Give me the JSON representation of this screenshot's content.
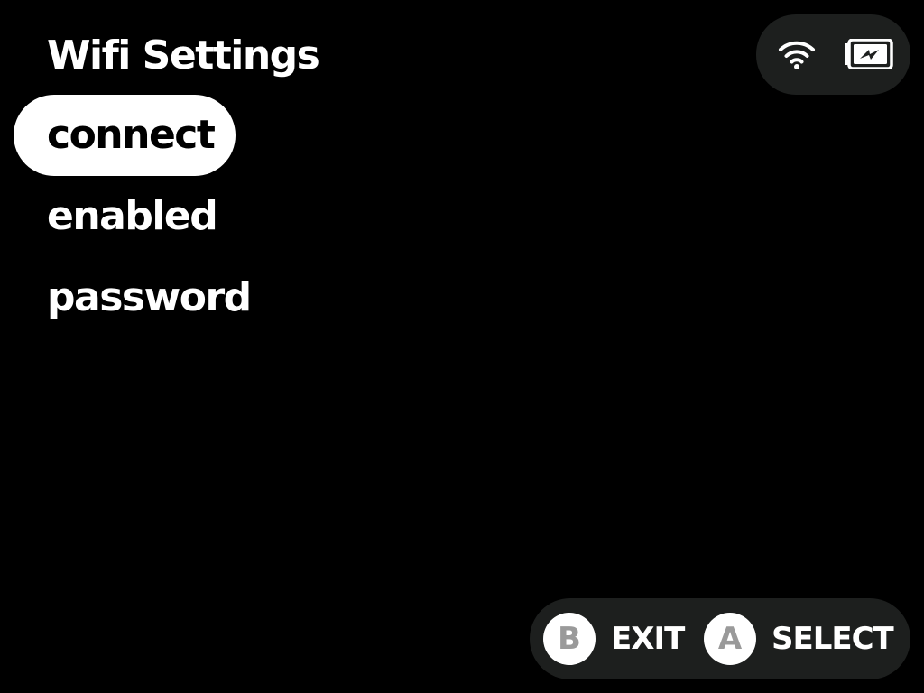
{
  "header": {
    "title": "Wifi Settings"
  },
  "status": {
    "wifi_icon": "wifi-icon",
    "battery_icon": "battery-charging-icon"
  },
  "menu": {
    "items": [
      {
        "label": "connect",
        "selected": true
      },
      {
        "label": "enabled",
        "selected": false
      },
      {
        "label": "password",
        "selected": false
      }
    ]
  },
  "hints": {
    "exit": {
      "button": "B",
      "label": "EXIT"
    },
    "select": {
      "button": "A",
      "label": "SELECT"
    }
  },
  "colors": {
    "background": "#000000",
    "pill_background": "#1d1f1e",
    "text": "#ffffff",
    "selected_background": "#ffffff",
    "selected_text": "#000000",
    "button_letter": "#9a9a9a"
  }
}
